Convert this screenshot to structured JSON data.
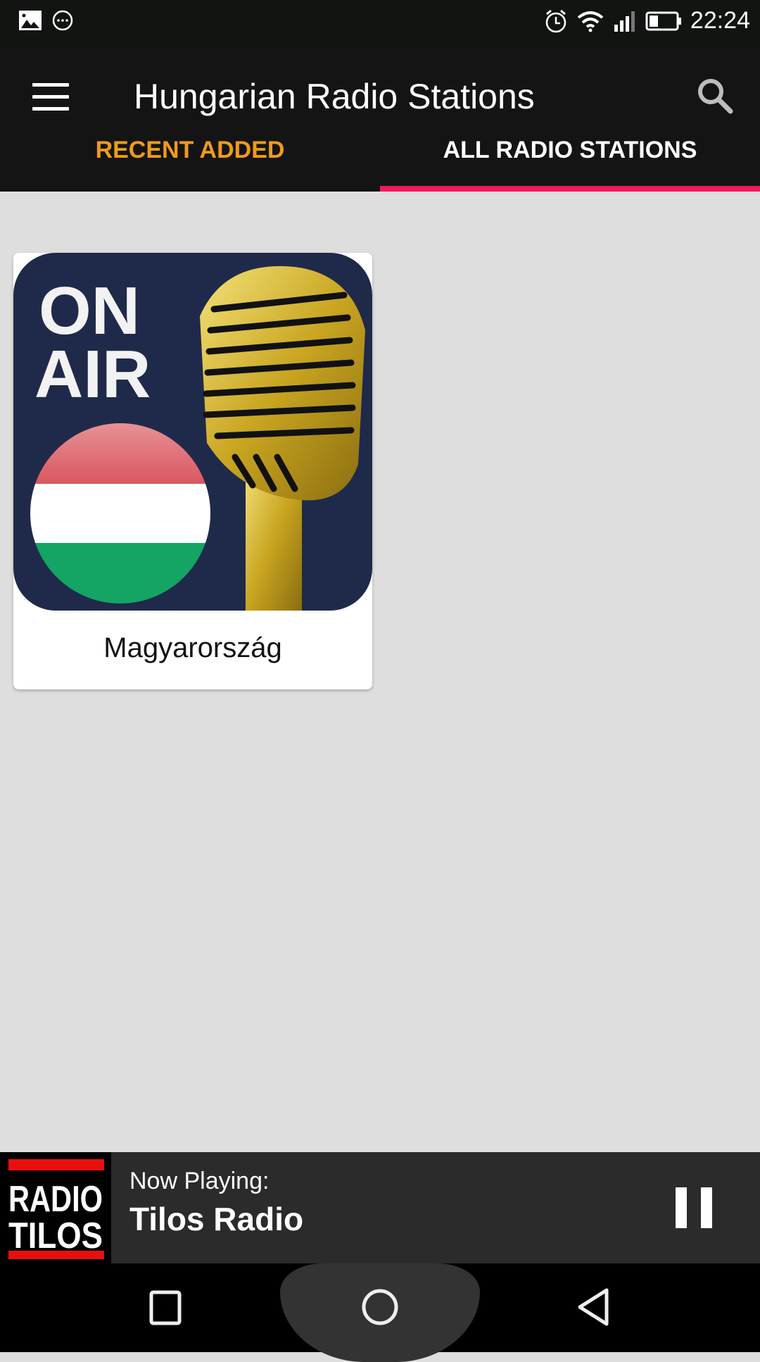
{
  "status_bar": {
    "time": "22:24",
    "left_icons": [
      "image-icon",
      "more-circle-icon"
    ],
    "right_icons": [
      "alarm-icon",
      "wifi-icon",
      "signal-icon",
      "battery-icon"
    ]
  },
  "app_bar": {
    "title": "Hungarian Radio Stations",
    "menu_icon": "hamburger-menu-icon",
    "search_icon": "search-icon"
  },
  "tabs": [
    {
      "label": "RECENT ADDED",
      "active": false
    },
    {
      "label": "ALL RADIO STATIONS",
      "active": true
    }
  ],
  "stations": [
    {
      "name": "Magyarország",
      "art_text_line1": "ON",
      "art_text_line2": "AIR"
    }
  ],
  "now_playing": {
    "caption": "Now Playing:",
    "station": "Tilos Radio",
    "logo_line1": "RADIO",
    "logo_line2": "TILOS",
    "control_icon": "pause-icon"
  },
  "nav_bar": {
    "buttons": [
      "recents-icon",
      "home-icon",
      "back-icon"
    ]
  },
  "colors": {
    "accent": "#f2195a",
    "inactive_tab": "#f19a1b",
    "app_bar": "#141414",
    "background": "#dedede"
  }
}
